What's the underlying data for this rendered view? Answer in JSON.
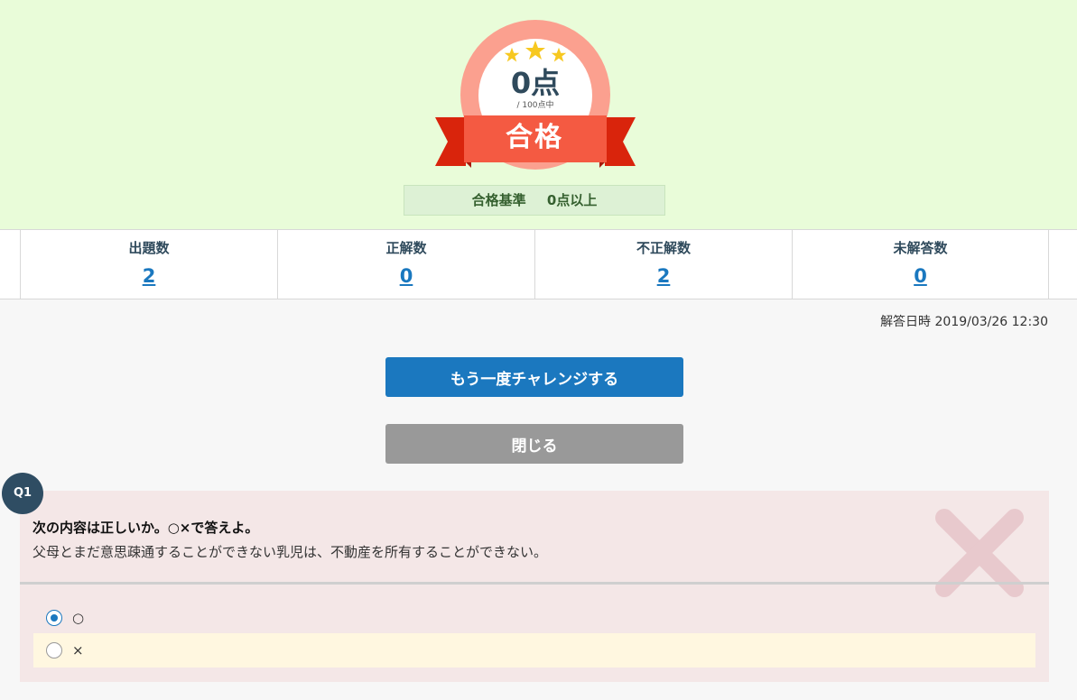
{
  "result": {
    "score": "0点",
    "score_sub": "/ 100点中",
    "status": "合格",
    "criteria_label": "合格基準",
    "criteria_value": "0点以上"
  },
  "stats": [
    {
      "label": "出題数",
      "value": "2"
    },
    {
      "label": "正解数",
      "value": "0"
    },
    {
      "label": "不正解数",
      "value": "2"
    },
    {
      "label": "未解答数",
      "value": "0"
    }
  ],
  "answer_date": "解答日時 2019/03/26 12:30",
  "buttons": {
    "retry": "もう一度チャレンジする",
    "close": "閉じる"
  },
  "question": {
    "number": "Q1",
    "title": "次の内容は正しいか。○×で答えよ。",
    "body": "父母とまだ意思疎通することができない乳児は、不動産を所有することができない。",
    "result_icon": "wrong-x-icon",
    "choices": [
      {
        "label": "○",
        "selected": true
      },
      {
        "label": "×",
        "selected": false
      }
    ]
  },
  "colors": {
    "header_bg": "#e9fcd9",
    "badge_ring": "#fba08f",
    "ribbon": "#f45a42",
    "primary": "#1b78bf",
    "close_button": "#999999",
    "question_bg": "#f4e7e7",
    "wrong_mark": "#e8c9cd"
  }
}
